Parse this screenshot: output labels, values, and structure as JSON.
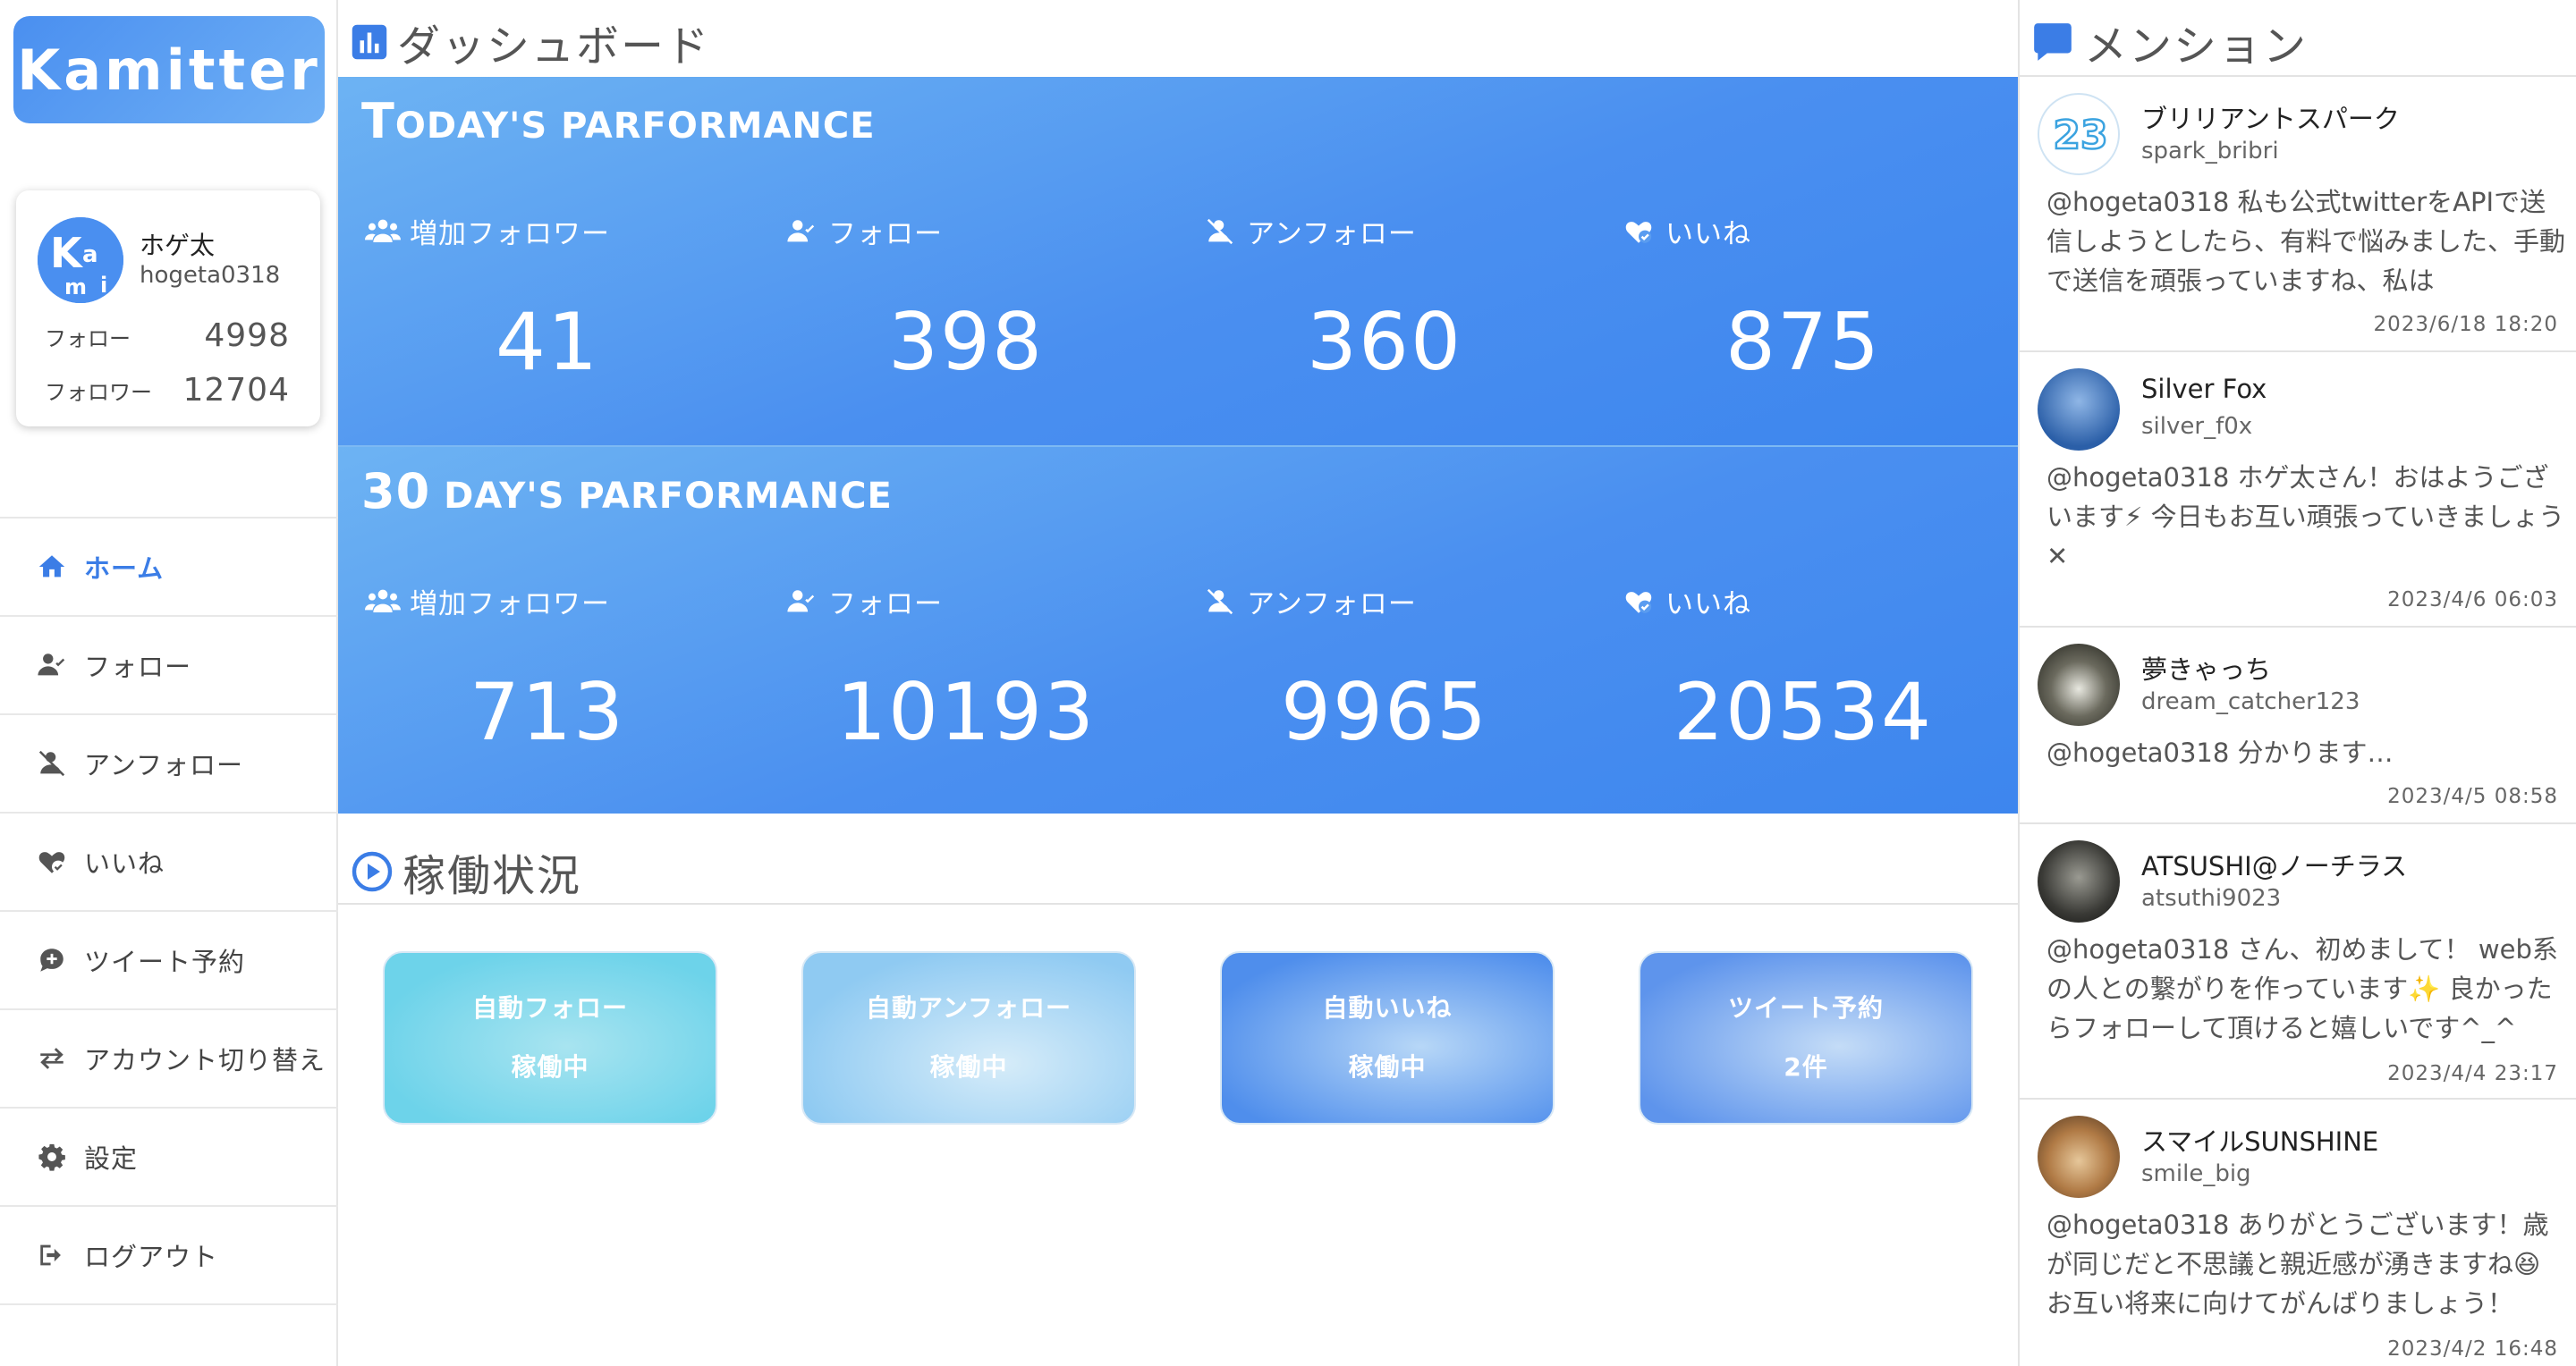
{
  "app": {
    "logo": "Kamitter"
  },
  "profile": {
    "name": "ホゲ太",
    "handle": "hogeta0318",
    "avatar_letters": [
      "K",
      "a",
      "m",
      "i"
    ],
    "follow_label": "フォロー",
    "follow_value": "4998",
    "follower_label": "フォロワー",
    "follower_value": "12704"
  },
  "nav": [
    {
      "label": "ホーム",
      "icon": "home-icon",
      "active": true
    },
    {
      "label": "フォロー",
      "icon": "user-check-icon"
    },
    {
      "label": "アンフォロー",
      "icon": "user-slash-icon"
    },
    {
      "label": "いいね",
      "icon": "heart-check-icon"
    },
    {
      "label": "ツイート予約",
      "icon": "comment-plus-icon"
    },
    {
      "label": "アカウント切り替え",
      "icon": "exchange-icon"
    },
    {
      "label": "設定",
      "icon": "gear-icon"
    },
    {
      "label": "ログアウト",
      "icon": "logout-icon"
    }
  ],
  "dashboard": {
    "title": "ダッシュボード",
    "today": {
      "title_big": "T",
      "title_rest": "ODAY'S PARFORMANCE",
      "metrics": [
        {
          "label": "増加フォロワー",
          "value": "41"
        },
        {
          "label": "フォロー",
          "value": "398"
        },
        {
          "label": "アンフォロー",
          "value": "360"
        },
        {
          "label": "いいね",
          "value": "875"
        }
      ]
    },
    "thirty": {
      "title_big": "30",
      "title_rest": " DAY'S PARFORMANCE",
      "metrics": [
        {
          "label": "増加フォロワー",
          "value": "713"
        },
        {
          "label": "フォロー",
          "value": "10193"
        },
        {
          "label": "アンフォロー",
          "value": "9965"
        },
        {
          "label": "いいね",
          "value": "20534"
        }
      ]
    }
  },
  "status": {
    "title": "稼働状況",
    "cards": [
      {
        "label": "自動フォロー",
        "state": "稼働中"
      },
      {
        "label": "自動アンフォロー",
        "state": "稼働中"
      },
      {
        "label": "自動いいね",
        "state": "稼働中"
      },
      {
        "label": "ツイート予約",
        "state": "2件"
      }
    ]
  },
  "mentions": {
    "title": "メンション",
    "items": [
      {
        "name": "ブリリアントスパーク",
        "handle": "spark_bribri",
        "text": "@hogeta0318 私も公式twitterをAPIで送信しようとしたら、有料で悩みました、手動で送信を頑張っていますね、私は",
        "date": "2023/6/18 18:20",
        "avatar": "23"
      },
      {
        "name": "Silver Fox",
        "handle": "silver_f0x",
        "text": "@hogeta0318 ホゲ太さん！おはようございます⚡ 今日もお互い頑張っていきましょう✕",
        "date": "2023/4/6 06:03",
        "avatar": ""
      },
      {
        "name": "夢きゃっち",
        "handle": "dream_catcher123",
        "text": "@hogeta0318 分かります…",
        "date": "2023/4/5 08:58",
        "avatar": ""
      },
      {
        "name": "ATSUSHI@ノーチラス",
        "handle": "atsuthi9023",
        "text": "@hogeta0318 さん、初めまして！ web系の人との繋がりを作っています✨ 良かったらフォローして頂けると嬉しいです^_^",
        "date": "2023/4/4 23:17",
        "avatar": ""
      },
      {
        "name": "スマイルSUNSHINE",
        "handle": "smile_big",
        "text": "@hogeta0318 ありがとうございます！歳が同じだと不思議と親近感が湧きますね😆 お互い将来に向けてがんばりましょう！",
        "date": "2023/4/2 16:48",
        "avatar": ""
      }
    ]
  },
  "colors": {
    "accent": "#3b7de6",
    "panel_start": "#6db3f3",
    "panel_end": "#3d86ee"
  }
}
